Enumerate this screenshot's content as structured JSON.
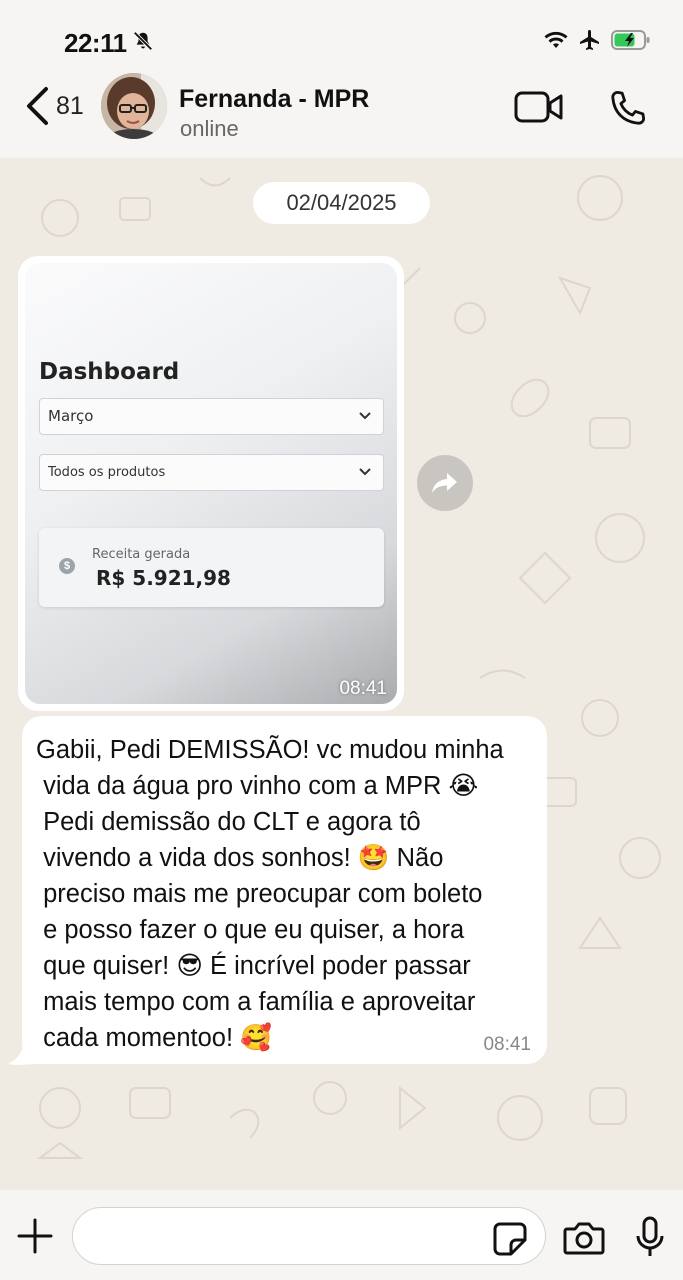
{
  "status_bar": {
    "time": "22:11"
  },
  "header": {
    "back_count": "81",
    "contact_name": "Fernanda - MPR",
    "contact_status": "online"
  },
  "chat": {
    "date_chip": "02/04/2025",
    "image_message": {
      "time": "08:41",
      "screenshot": {
        "title": "Dashboard",
        "month_select": "Março",
        "product_select": "Todos os produtos",
        "revenue_label": "Receita gerada",
        "revenue_value": "R$ 5.921,98"
      }
    },
    "text_message": {
      "text": "Gabii, Pedi DEMISSÃO! vc mudou minha\n vida da água pro vinho com a MPR 😭\n Pedi demissão do CLT e agora tô\n vivendo a vida dos sonhos! 🤩 Não\n preciso mais me preocupar com boleto\n e posso fazer o que eu quiser, a hora\n que quiser! 😎 É incrível poder passar\n mais tempo com a família e aproveitar\n cada momentoo! 🥰",
      "time": "08:41"
    }
  },
  "input_bar": {
    "placeholder": ""
  },
  "colors": {
    "chat_background": "#efeae2",
    "bubble": "#ffffff",
    "bars": "#f6f5f3",
    "battery": "#34c759"
  }
}
